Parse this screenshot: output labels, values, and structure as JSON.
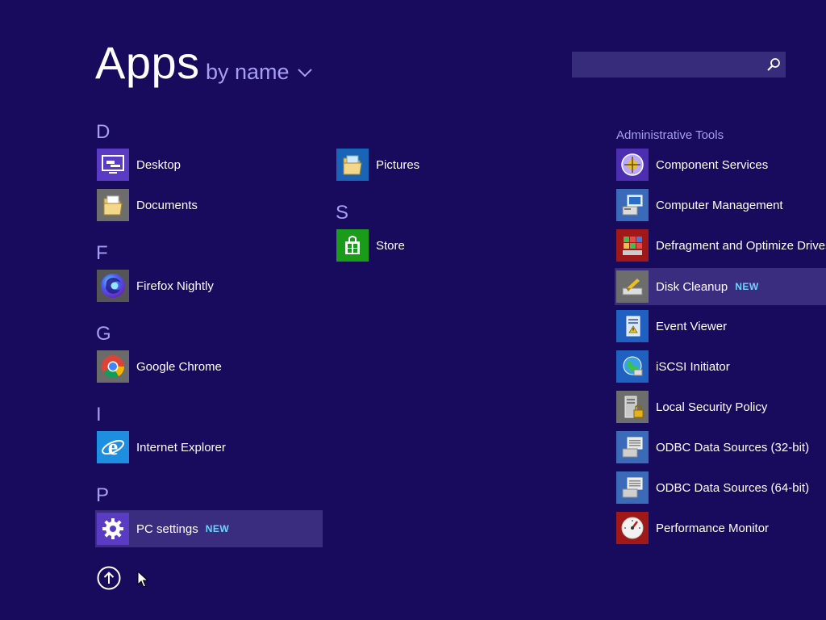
{
  "header": {
    "title": "Apps",
    "sort_label": "by name",
    "search_placeholder": ""
  },
  "colors": {
    "background": "#180b5e",
    "accent_text": "#a69ef0",
    "highlight": "#3a2d7f",
    "new_badge": "#6fd3ff"
  },
  "column1": {
    "sections": [
      {
        "letter": "D",
        "items": [
          {
            "label": "Desktop",
            "icon": "desktop-icon"
          },
          {
            "label": "Documents",
            "icon": "documents-folder-icon"
          }
        ]
      },
      {
        "letter": "F",
        "items": [
          {
            "label": "Firefox Nightly",
            "icon": "firefox-nightly-icon"
          }
        ]
      },
      {
        "letter": "G",
        "items": [
          {
            "label": "Google Chrome",
            "icon": "chrome-icon"
          }
        ]
      },
      {
        "letter": "I",
        "items": [
          {
            "label": "Internet Explorer",
            "icon": "internet-explorer-icon"
          }
        ]
      },
      {
        "letter": "P",
        "items": [
          {
            "label": "PC settings",
            "icon": "gear-icon",
            "badge": "NEW"
          }
        ]
      }
    ]
  },
  "column2": {
    "items_top": [
      {
        "label": "Pictures",
        "icon": "pictures-folder-icon"
      }
    ],
    "sections": [
      {
        "letter": "S",
        "items": [
          {
            "label": "Store",
            "icon": "store-icon"
          }
        ]
      }
    ]
  },
  "column3": {
    "group": "Administrative Tools",
    "items": [
      {
        "label": "Component Services",
        "icon": "component-services-icon"
      },
      {
        "label": "Computer Management",
        "icon": "computer-management-icon"
      },
      {
        "label": "Defragment and Optimize Drives",
        "icon": "defragment-icon"
      },
      {
        "label": "Disk Cleanup",
        "icon": "disk-cleanup-icon",
        "badge": "NEW"
      },
      {
        "label": "Event Viewer",
        "icon": "event-viewer-icon"
      },
      {
        "label": "iSCSI Initiator",
        "icon": "iscsi-initiator-icon"
      },
      {
        "label": "Local Security Policy",
        "icon": "local-security-policy-icon"
      },
      {
        "label": "ODBC Data Sources (32-bit)",
        "icon": "odbc-icon"
      },
      {
        "label": "ODBC Data Sources (64-bit)",
        "icon": "odbc-icon"
      },
      {
        "label": "Performance Monitor",
        "icon": "performance-monitor-icon"
      }
    ]
  },
  "footer": {
    "scroll_up_icon": "arrow-up-circle-icon"
  }
}
